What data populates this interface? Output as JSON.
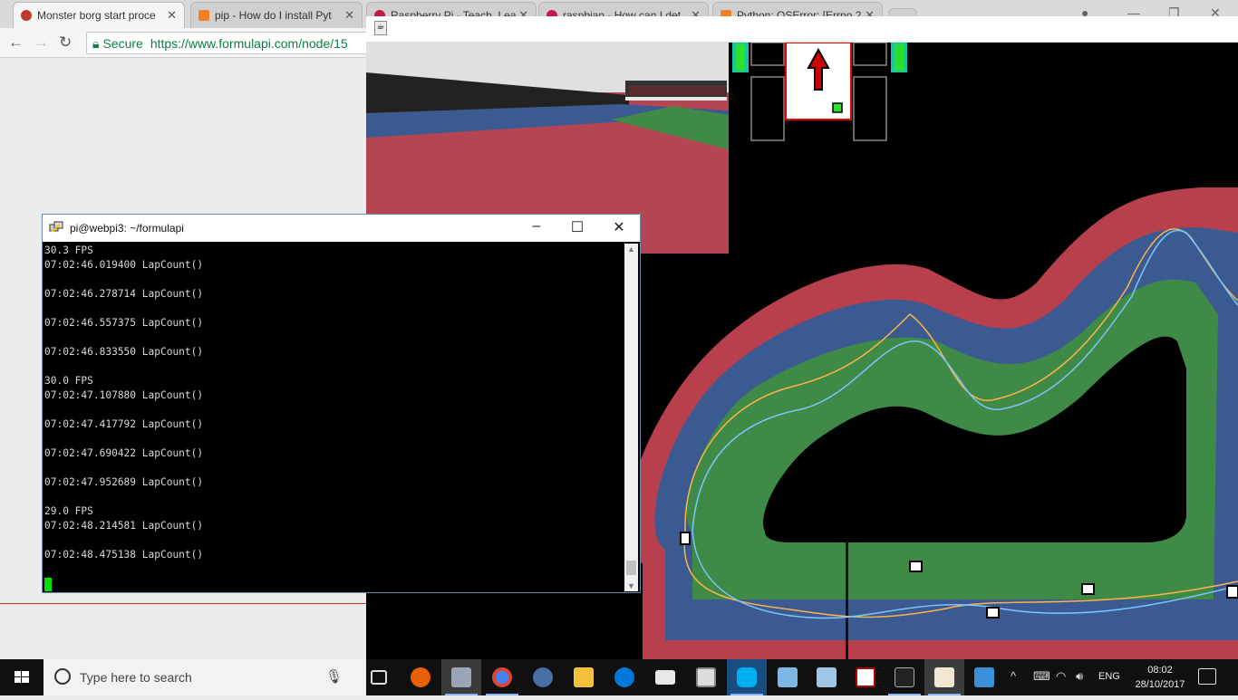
{
  "browser": {
    "tabs": [
      {
        "title": "Monster borg start proce",
        "color": "#c0392b",
        "active": true
      },
      {
        "title": "pip - How do I install Pyt",
        "color": "#f48024",
        "active": false
      },
      {
        "title": "Raspberry Pi - Teach, Lea",
        "color": "#c51a4a",
        "active": false
      },
      {
        "title": "raspbian - How can I det",
        "color": "#c51a4a",
        "active": false
      },
      {
        "title": "Python: OSError: [Errno 2",
        "color": "#f48024",
        "active": false
      }
    ],
    "back_icon": "back-arrow-icon",
    "forward_icon": "forward-arrow-icon",
    "reload_icon": "reload-icon",
    "secure_label": "Secure",
    "url": "https://www.formulapi.com/node/15"
  },
  "putty": {
    "title": "pi@webpi3: ~/formulapi",
    "minimize": "–",
    "maximize": "☐",
    "close": "✕",
    "lines": [
      "30.3 FPS",
      "07:02:46.019400 LapCount()",
      "",
      "07:02:46.278714 LapCount()",
      "",
      "07:02:46.557375 LapCount()",
      "",
      "07:02:46.833550 LapCount()",
      "",
      "30.0 FPS",
      "07:02:47.107880 LapCount()",
      "",
      "07:02:47.417792 LapCount()",
      "",
      "07:02:47.690422 LapCount()",
      "",
      "07:02:47.952689 LapCount()",
      "",
      "29.0 FPS",
      "07:02:48.214581 LapCount()",
      "",
      "07:02:48.475138 LapCount()",
      ""
    ]
  },
  "taskbar": {
    "search_placeholder": "Type here to search",
    "language": "ENG",
    "time": "08:02",
    "date": "28/10/2017"
  },
  "colors": {
    "track_red": "#b8404d",
    "track_blue": "#3c5a92",
    "track_green": "#3f8a47",
    "path_orange": "#ffb347",
    "path_cyan": "#79c6ff"
  }
}
